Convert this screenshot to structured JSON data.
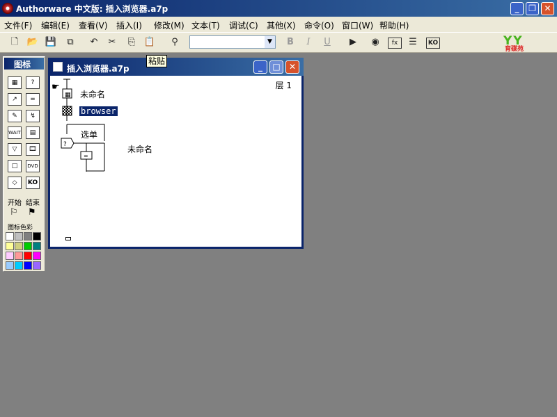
{
  "window": {
    "title": "Authorware 中文版: 插入浏览器.a7p"
  },
  "menu": [
    "文件(F)",
    "编辑(E)",
    "查看(V)",
    "插入(I)",
    "修改(M)",
    "文本(T)",
    "调试(C)",
    "其他(X)",
    "命令(O)",
    "窗口(W)",
    "帮助(H)"
  ],
  "toolbar": {
    "icons": [
      "new-file-icon",
      "open-file-icon",
      "save-all-icon",
      "import-icon",
      "undo-icon",
      "cut-icon",
      "copy-icon",
      "paste-icon",
      "find-icon"
    ],
    "text_style": {
      "bold": "B",
      "italic": "I",
      "underline": "U"
    },
    "tooltip": "粘贴"
  },
  "logo": {
    "text": "YY",
    "sub": "育碟苑"
  },
  "palette": {
    "title": "图标",
    "start_label": "开始",
    "end_label": "结束",
    "color_title": "图标色彩",
    "colors": [
      "#ffffff",
      "#c0c0c0",
      "#808080",
      "#000000",
      "#ffff99",
      "#d0d080",
      "#00cc00",
      "#008080",
      "#ffccff",
      "#ff9999",
      "#ff0000",
      "#ff00ff",
      "#99ccff",
      "#00ccff",
      "#0000ff",
      "#9966ff"
    ]
  },
  "design_window": {
    "title": "插入浏览器.a7p",
    "level": "层 1",
    "icons": [
      {
        "label": "未命名"
      },
      {
        "label": "browser"
      },
      {
        "label": "选单"
      },
      {
        "label": "未命名"
      }
    ]
  }
}
